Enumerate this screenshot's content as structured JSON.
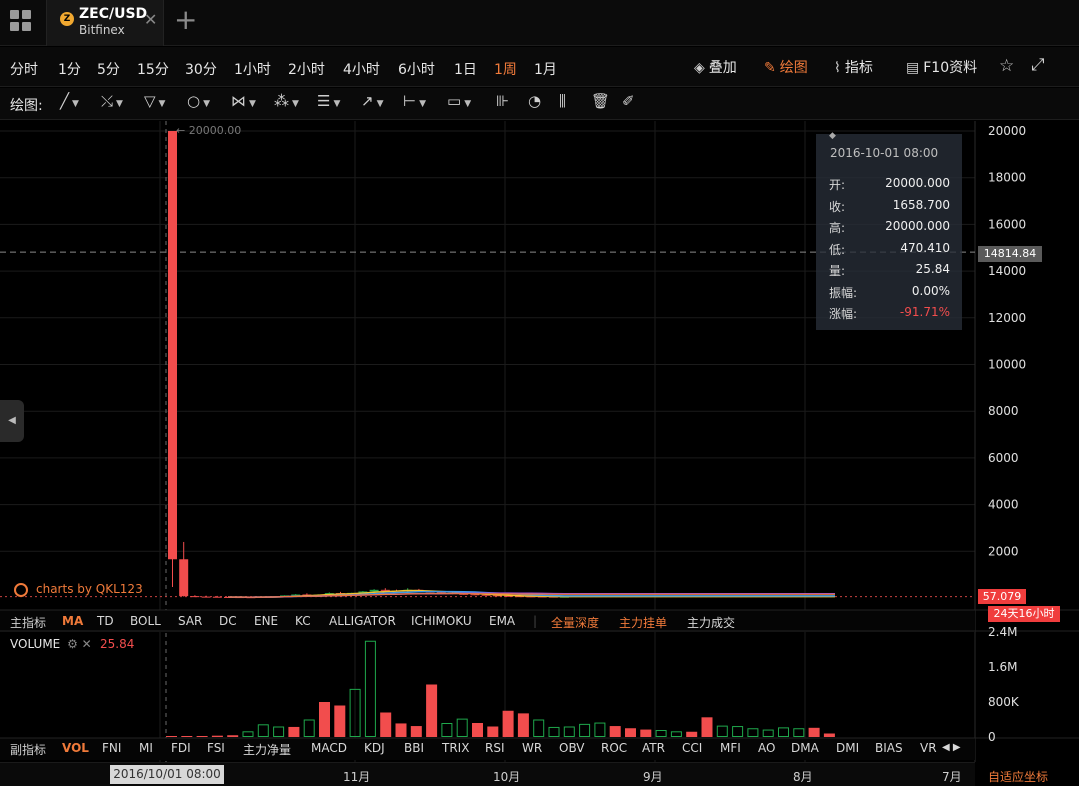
{
  "tab": {
    "pair": "ZEC/USD",
    "exchange": "Bitfinex",
    "coin_glyph": "Z",
    "close": "✕",
    "add": "+"
  },
  "periods": [
    "分时",
    "1分",
    "5分",
    "15分",
    "30分",
    "1小时",
    "2小时",
    "4小时",
    "6小时",
    "1日",
    "1周",
    "1月"
  ],
  "active_period": "1周",
  "right_tools": [
    {
      "icon": "layers-icon",
      "glyph": "◈",
      "label": "叠加",
      "active": false
    },
    {
      "icon": "pen-icon",
      "glyph": "✎",
      "label": "绘图",
      "active": true
    },
    {
      "icon": "indicator-icon",
      "glyph": "⌇",
      "label": "指标",
      "active": false
    },
    {
      "icon": "document-icon",
      "glyph": "▤",
      "label": "F10资料",
      "active": false
    }
  ],
  "favorite_glyph": "☆",
  "fullscreen_glyph": "⤢",
  "draw_label": "绘图:",
  "draw_tools": [
    {
      "name": "line-tool-icon",
      "glyph": "╱"
    },
    {
      "name": "trend-tool-icon",
      "glyph": "⤯"
    },
    {
      "name": "triangle-tool-icon",
      "glyph": "▽"
    },
    {
      "name": "circle-tool-icon",
      "glyph": "○"
    },
    {
      "name": "wave-tool-icon",
      "glyph": "⋈"
    },
    {
      "name": "pattern-tool-icon",
      "glyph": "⁂"
    },
    {
      "name": "fib-tool-icon",
      "glyph": "☰"
    },
    {
      "name": "arrow-tool-icon",
      "glyph": "↗"
    },
    {
      "name": "measure-tool-icon",
      "glyph": "⊢"
    },
    {
      "name": "comment-tool-icon",
      "glyph": "▭"
    }
  ],
  "draw_actions": [
    {
      "name": "bar-style-icon",
      "glyph": "⊪"
    },
    {
      "name": "candle-style-icon",
      "glyph": "◔"
    },
    {
      "name": "hist-style-icon",
      "glyph": "⫼"
    },
    {
      "name": "trash-icon",
      "glyph": "🗑"
    },
    {
      "name": "brush-icon",
      "glyph": "✐"
    }
  ],
  "tooltip": {
    "date": "2016-10-01 08:00",
    "rows": [
      {
        "k": "开:",
        "v": "20000.000"
      },
      {
        "k": "收:",
        "v": "1658.700"
      },
      {
        "k": "高:",
        "v": "20000.000"
      },
      {
        "k": "低:",
        "v": "470.410"
      },
      {
        "k": "量:",
        "v": "25.84"
      },
      {
        "k": "振幅:",
        "v": "0.00%"
      },
      {
        "k": "涨幅:",
        "v": "-91.71%",
        "neg": true
      }
    ]
  },
  "price_axis": [
    "20000",
    "18000",
    "16000",
    "14000",
    "12000",
    "10000",
    "8000",
    "6000",
    "4000",
    "2000"
  ],
  "cross_price": "14814.84",
  "last_price": "57.079",
  "countdown": "24天16小时",
  "peak_label": "← 20000.00",
  "watermark": "charts by QKL123",
  "main_indicators": {
    "label": "主指标",
    "items": [
      "MA",
      "TD",
      "BOLL",
      "SAR",
      "DC",
      "ENE",
      "KC",
      "ALLIGATOR",
      "ICHIMOKU",
      "EMA"
    ],
    "active": "MA",
    "extra": [
      "全量深度",
      "主力挂单",
      "主力成交"
    ]
  },
  "volume": {
    "title": "VOLUME",
    "gear": "⚙",
    "close": "✕",
    "value": "25.84",
    "axis": [
      "2.4M",
      "1.6M",
      "800K",
      "0"
    ]
  },
  "sub_indicators": {
    "label": "副指标",
    "items": [
      "VOL",
      "FNI",
      "MI",
      "FDI",
      "FSI",
      "主力净量",
      "MACD",
      "KDJ",
      "BBI",
      "TRIX",
      "RSI",
      "WR",
      "OBV",
      "ROC",
      "ATR",
      "CCI",
      "MFI",
      "AO",
      "DMA",
      "DMI",
      "BIAS",
      "VR"
    ],
    "active": "VOL",
    "arrows": "◀ ▶"
  },
  "date_axis": [
    "11月",
    "10月",
    "9月",
    "8月",
    "7月"
  ],
  "date_cross": "2016/10/01 08:00",
  "autoscale": "自适应坐标",
  "colors": {
    "up": "#1fa84c",
    "down": "#f24d4d",
    "accent": "#f07a3a",
    "bg": "#000000"
  },
  "chart_data": {
    "type": "candlestick",
    "price_ylim": [
      0,
      20000
    ],
    "volume_ylim": [
      0,
      2400000
    ],
    "candles": [
      {
        "o": 20000,
        "h": 20000,
        "l": 470,
        "c": 1659
      },
      {
        "o": 1659,
        "h": 2400,
        "l": 60,
        "c": 80
      },
      {
        "o": 80,
        "h": 120,
        "l": 40,
        "c": 60
      },
      {
        "o": 60,
        "h": 100,
        "l": 40,
        "c": 55
      },
      {
        "o": 55,
        "h": 90,
        "l": 35,
        "c": 45
      },
      {
        "o": 45,
        "h": 80,
        "l": 30,
        "c": 40
      },
      {
        "o": 40,
        "h": 70,
        "l": 30,
        "c": 35
      },
      {
        "o": 35,
        "h": 60,
        "l": 25,
        "c": 30
      },
      {
        "o": 30,
        "h": 55,
        "l": 25,
        "c": 48
      },
      {
        "o": 48,
        "h": 70,
        "l": 40,
        "c": 62
      },
      {
        "o": 62,
        "h": 120,
        "l": 55,
        "c": 110
      },
      {
        "o": 110,
        "h": 170,
        "l": 90,
        "c": 150
      },
      {
        "o": 150,
        "h": 200,
        "l": 120,
        "c": 130
      },
      {
        "o": 130,
        "h": 160,
        "l": 110,
        "c": 145
      },
      {
        "o": 145,
        "h": 240,
        "l": 130,
        "c": 210
      },
      {
        "o": 210,
        "h": 260,
        "l": 180,
        "c": 190
      },
      {
        "o": 190,
        "h": 230,
        "l": 170,
        "c": 220
      },
      {
        "o": 220,
        "h": 300,
        "l": 200,
        "c": 280
      },
      {
        "o": 280,
        "h": 380,
        "l": 250,
        "c": 350
      },
      {
        "o": 350,
        "h": 420,
        "l": 300,
        "c": 320
      },
      {
        "o": 320,
        "h": 360,
        "l": 280,
        "c": 300
      },
      {
        "o": 300,
        "h": 420,
        "l": 260,
        "c": 350
      },
      {
        "o": 350,
        "h": 390,
        "l": 250,
        "c": 270
      },
      {
        "o": 270,
        "h": 300,
        "l": 230,
        "c": 260
      },
      {
        "o": 260,
        "h": 290,
        "l": 200,
        "c": 220
      },
      {
        "o": 220,
        "h": 240,
        "l": 160,
        "c": 180
      },
      {
        "o": 180,
        "h": 210,
        "l": 140,
        "c": 160
      },
      {
        "o": 160,
        "h": 190,
        "l": 120,
        "c": 140
      },
      {
        "o": 140,
        "h": 160,
        "l": 100,
        "c": 115
      },
      {
        "o": 115,
        "h": 130,
        "l": 85,
        "c": 95
      },
      {
        "o": 95,
        "h": 110,
        "l": 70,
        "c": 80
      },
      {
        "o": 80,
        "h": 95,
        "l": 60,
        "c": 70
      },
      {
        "o": 70,
        "h": 85,
        "l": 55,
        "c": 65
      },
      {
        "o": 65,
        "h": 80,
        "l": 50,
        "c": 60
      },
      {
        "o": 60,
        "h": 75,
        "l": 45,
        "c": 55
      },
      {
        "o": 55,
        "h": 70,
        "l": 45,
        "c": 57
      }
    ],
    "volumes": [
      25.84,
      20000,
      15000,
      30000,
      40000,
      130000,
      290000,
      240000,
      230000,
      400000,
      800000,
      720000,
      1100000,
      2200000,
      560000,
      310000,
      250000,
      1200000,
      320000,
      420000,
      320000,
      240000,
      600000,
      540000,
      400000,
      230000,
      240000,
      300000,
      330000,
      250000,
      200000,
      170000,
      160000,
      130000,
      120000,
      450000,
      260000,
      250000,
      200000,
      170000,
      220000,
      200000,
      210000,
      80000
    ],
    "volume_up": [
      false,
      false,
      false,
      false,
      false,
      true,
      true,
      true,
      false,
      true,
      false,
      false,
      true,
      true,
      false,
      false,
      false,
      false,
      true,
      true,
      false,
      false,
      false,
      false,
      true,
      true,
      true,
      true,
      true,
      false,
      false,
      false,
      true,
      true,
      false,
      false,
      true,
      true,
      true,
      true,
      true,
      true,
      false,
      false
    ]
  }
}
